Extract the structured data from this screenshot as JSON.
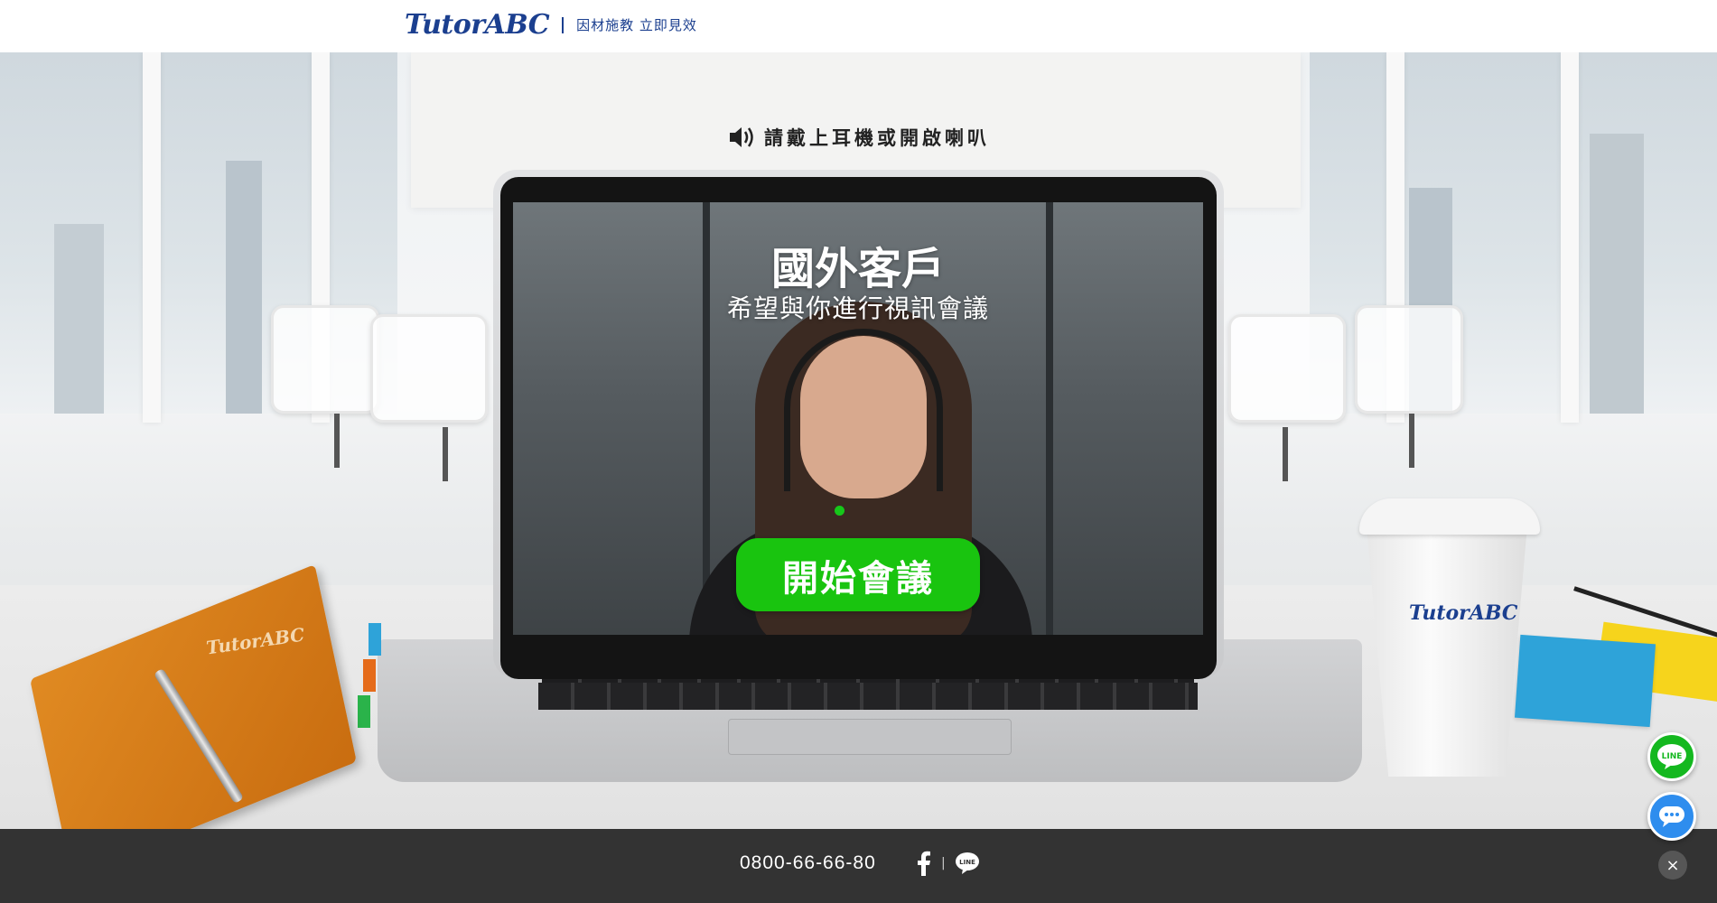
{
  "header": {
    "logo_text": "TutorABC",
    "slogan": "因材施教 立即見效"
  },
  "speaker_prompt": {
    "icon": "speaker-icon",
    "text": "請戴上耳機或開啟喇叭"
  },
  "screen": {
    "title": "國外客戶",
    "subtitle": "希望與你進行視訊會議"
  },
  "start_button": {
    "label": "開始會議",
    "color": "#19c40f"
  },
  "props": {
    "notebook_logo": "TutorABC",
    "cup_logo": "TutorABC"
  },
  "floating_buttons": {
    "line_label": "LINE",
    "line_color": "#14b81f",
    "chat_icon": "chat-bubble-icon",
    "chat_color": "#2e8dee"
  },
  "footer": {
    "phone": "0800-66-66-80",
    "separator": "|",
    "facebook_icon": "facebook-icon",
    "line_icon": "line-icon",
    "close_label": "×"
  },
  "colors": {
    "brand": "#1b3f8f",
    "footer_bg": "#333333"
  }
}
